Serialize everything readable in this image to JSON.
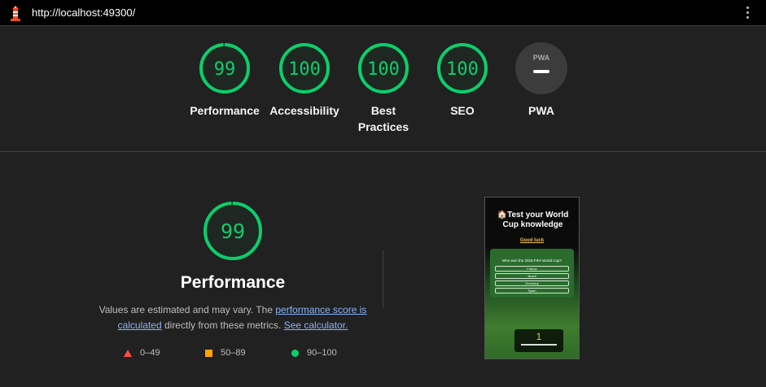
{
  "topbar": {
    "url": "http://localhost:49300/"
  },
  "categories": [
    {
      "score": "99",
      "label": "Performance",
      "value": 99
    },
    {
      "score": "100",
      "label": "Accessibility",
      "value": 100
    },
    {
      "score": "100",
      "label": "Best Practices",
      "value": 100
    },
    {
      "score": "100",
      "label": "SEO",
      "value": 100
    },
    {
      "score": "",
      "label": "PWA",
      "badge": "PWA"
    }
  ],
  "performance": {
    "score": "99",
    "value": 99,
    "title": "Performance",
    "desc_prefix": "Values are estimated and may vary. The ",
    "link_score": "performance score is calculated",
    "desc_middle": " directly from these metrics. ",
    "link_calc": "See calculator."
  },
  "legend": {
    "fail": "0–49",
    "average": "50–89",
    "pass": "90–100"
  },
  "screenshot": {
    "title": "🏠Test your World Cup knowledge",
    "subtitle": "Good luck",
    "question": "Who won the 2018 FIFA World Cup?",
    "options": [
      "France",
      "Brazil",
      "Germany",
      "Spain"
    ],
    "counter": "1"
  },
  "colors": {
    "pass": "#0cce6b",
    "average": "#ffa400",
    "fail": "#ff4e42",
    "background": "#212121"
  }
}
